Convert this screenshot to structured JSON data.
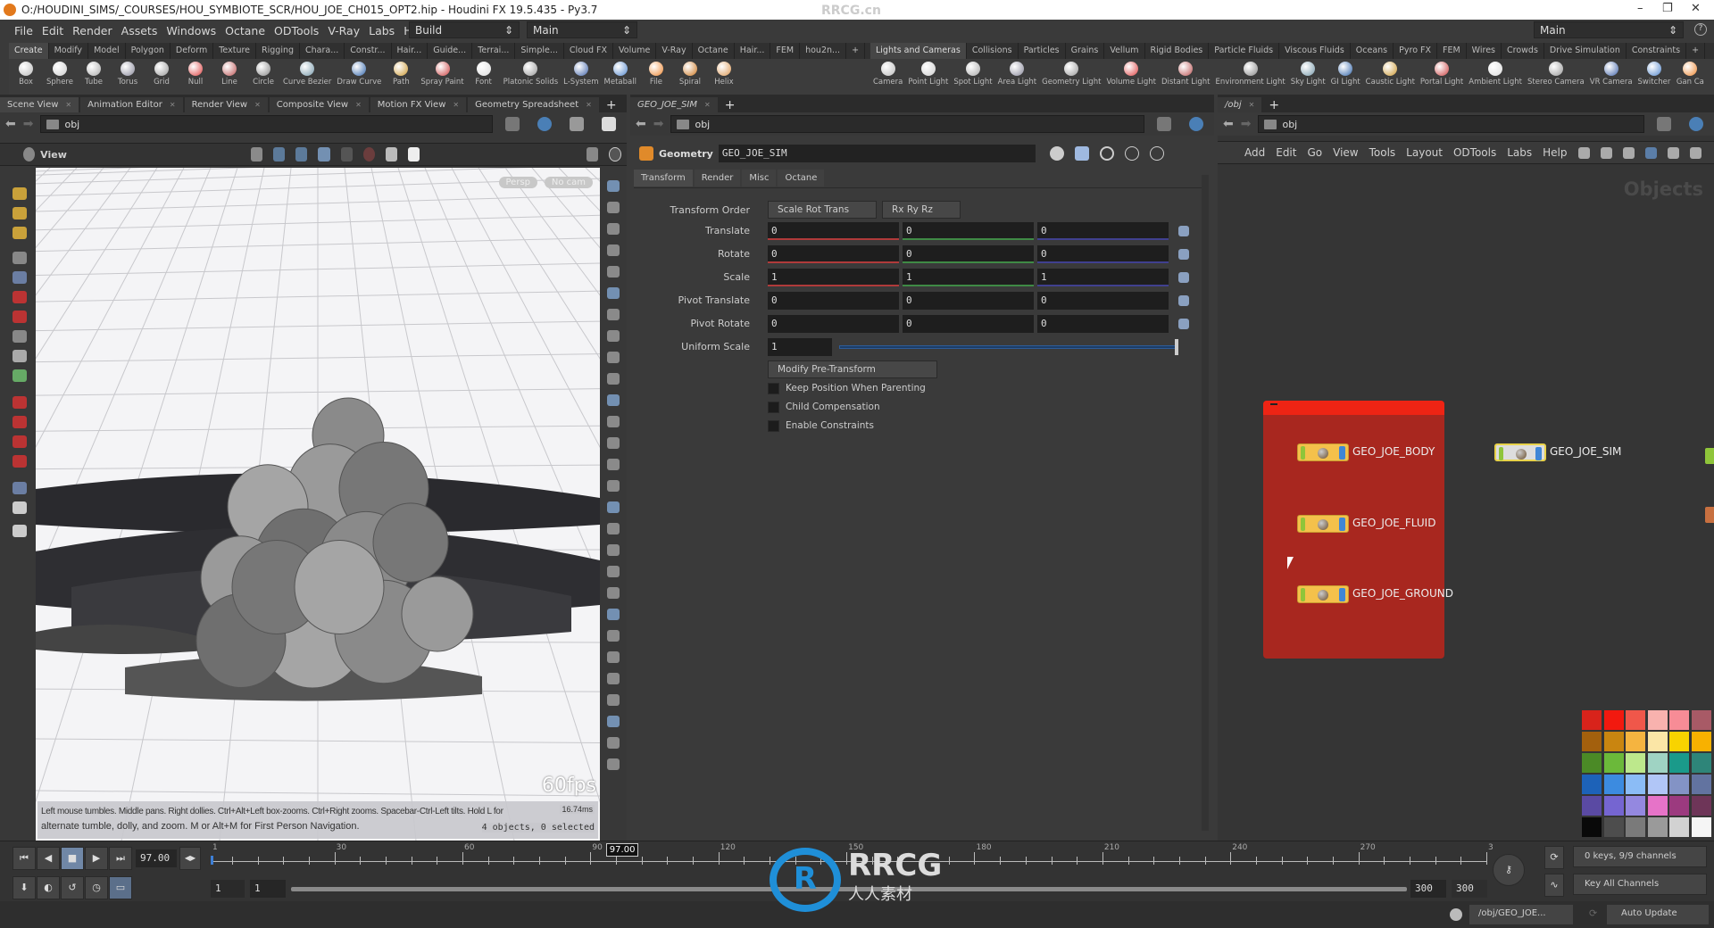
{
  "window": {
    "title": "O:/HOUDINI_SIMS/_COURSES/HOU_SYMBIOTE_SCR/HOU_JOE_CH015_OPT2.hip - Houdini FX 19.5.435 - Py3.7",
    "minimize": "–",
    "maximize": "❐",
    "close": "✕"
  },
  "menu": {
    "items": [
      "File",
      "Edit",
      "Render",
      "Assets",
      "Windows",
      "Octane",
      "ODTools",
      "V-Ray",
      "Labs",
      "Help"
    ],
    "desktop": "Build",
    "desktop2": "Main",
    "desktop_right": "Main",
    "help": "?"
  },
  "shelf_left": {
    "tabs": [
      "Create",
      "Modify",
      "Model",
      "Polygon",
      "Deform",
      "Texture",
      "Rigging",
      "Chara...",
      "Constr...",
      "Hair...",
      "Guide...",
      "Terrai...",
      "Simple...",
      "Cloud FX",
      "Volume",
      "V-Ray",
      "Octane",
      "Hair...",
      "FEM",
      "hou2n..."
    ],
    "tools": [
      "Box",
      "Sphere",
      "Tube",
      "Torus",
      "Grid",
      "Null",
      "Line",
      "Circle",
      "Curve Bezier",
      "Draw Curve",
      "Path",
      "Spray Paint",
      "Font",
      "Platonic Solids",
      "L-System",
      "Metaball",
      "File",
      "Spiral",
      "Helix"
    ]
  },
  "shelf_right": {
    "tabs": [
      "Lights and Cameras",
      "Collisions",
      "Particles",
      "Grains",
      "Vellum",
      "Rigid Bodies",
      "Particle Fluids",
      "Viscous Fluids",
      "Oceans",
      "Pyro FX",
      "FEM",
      "Wires",
      "Crowds",
      "Drive Simulation",
      "Constraints"
    ],
    "tools": [
      "Camera",
      "Point Light",
      "Spot Light",
      "Area Light",
      "Geometry Light",
      "Volume Light",
      "Distant Light",
      "Environment Light",
      "Sky Light",
      "GI Light",
      "Caustic Light",
      "Portal Light",
      "Ambient Light",
      "Stereo Camera",
      "VR Camera",
      "Switcher",
      "Gan Ca"
    ]
  },
  "scene_pane": {
    "tabs": [
      "Scene View",
      "Animation Editor",
      "Render View",
      "Composite View",
      "Motion FX View",
      "Geometry Spreadsheet"
    ],
    "path": "obj",
    "view_label": "View",
    "persp": "Persp",
    "cam": "No cam",
    "fps": "60fps",
    "ms": "16.74ms",
    "hint1": "Left mouse tumbles. Middle pans. Right dollies. Ctrl+Alt+Left box-zooms. Ctrl+Right zooms. Spacebar-Ctrl-Left tilts. Hold L for",
    "hint2": "alternate tumble, dolly, and zoom.    M or Alt+M for First Person Navigation.",
    "objects": "4 objects, 0 selected"
  },
  "param_pane": {
    "tab": "GEO_JOE_SIM",
    "path": "obj",
    "node_type": "Geometry",
    "node_name": "GEO_JOE_SIM",
    "tabs": [
      "Transform",
      "Render",
      "Misc",
      "Octane"
    ],
    "transform_order_label": "Transform Order",
    "transform_order": "Scale Rot Trans",
    "rot_order": "Rx Ry Rz",
    "rows": [
      {
        "label": "Translate",
        "values": [
          "0",
          "0",
          "0"
        ]
      },
      {
        "label": "Rotate",
        "values": [
          "0",
          "0",
          "0"
        ]
      },
      {
        "label": "Scale",
        "values": [
          "1",
          "1",
          "1"
        ]
      },
      {
        "label": "Pivot Translate",
        "values": [
          "0",
          "0",
          "0"
        ]
      },
      {
        "label": "Pivot Rotate",
        "values": [
          "0",
          "0",
          "0"
        ]
      }
    ],
    "uniform_scale_label": "Uniform Scale",
    "uniform_scale": "1",
    "uniform_scale_slider": 1.0,
    "modify_pre": "Modify Pre-Transform",
    "checks": [
      {
        "label": "Keep Position When Parenting",
        "checked": false
      },
      {
        "label": "Child Compensation",
        "checked": false
      },
      {
        "label": "Enable Constraints",
        "checked": false
      }
    ]
  },
  "network_pane": {
    "tab": "/obj",
    "path": "obj",
    "menu": [
      "Add",
      "Edit",
      "Go",
      "View",
      "Tools",
      "Layout",
      "ODTools",
      "Labs",
      "Help"
    ],
    "context": "Objects",
    "network_box_color": "#a8271f",
    "nodes": [
      {
        "name": "GEO_JOE_BODY"
      },
      {
        "name": "GEO_JOE_FLUID"
      },
      {
        "name": "GEO_JOE_GROUND"
      },
      {
        "name": "GEO_JOE_SIM"
      }
    ],
    "palette": [
      "#d8231b",
      "#f2190f",
      "#f0574a",
      "#f8b2ae",
      "#f78c96",
      "#a85a66",
      "#a3600d",
      "#c98510",
      "#f5b440",
      "#fbe6a6",
      "#f8d300",
      "#f8b100",
      "#4b8a26",
      "#6bb93a",
      "#bde88c",
      "#9fd3c3",
      "#1a9a8a",
      "#2e8579",
      "#1d62b8",
      "#3c8be0",
      "#8bbcf6",
      "#b1c6f7",
      "#8393c5",
      "#6273a0",
      "#5a4aa3",
      "#7565d1",
      "#9488e0",
      "#e673c8",
      "#9c3a7f",
      "#6e3558",
      "#090909",
      "#4d4d4d",
      "#7a7a7a",
      "#9a9a9a",
      "#d2d2d2",
      "#f5f5f5"
    ]
  },
  "timeline": {
    "current_frame": "97.00",
    "marker": "97.00",
    "start": 1,
    "end": 300,
    "tick_labels": [
      "1",
      "30",
      "60",
      "90",
      "120",
      "150",
      "180",
      "210",
      "240",
      "270",
      "3"
    ],
    "range_start": "1",
    "range_start2": "1",
    "range_end": "300",
    "range_end2": "300",
    "keys": "0 keys, 9/9 channels",
    "key_mode": "Key All Channels"
  },
  "status": {
    "path": "/obj/GEO_JOE...",
    "update": "Auto Update"
  },
  "watermark": {
    "brand": "RRCG",
    "sub": "人人素材",
    "top": "RRCG.cn"
  }
}
